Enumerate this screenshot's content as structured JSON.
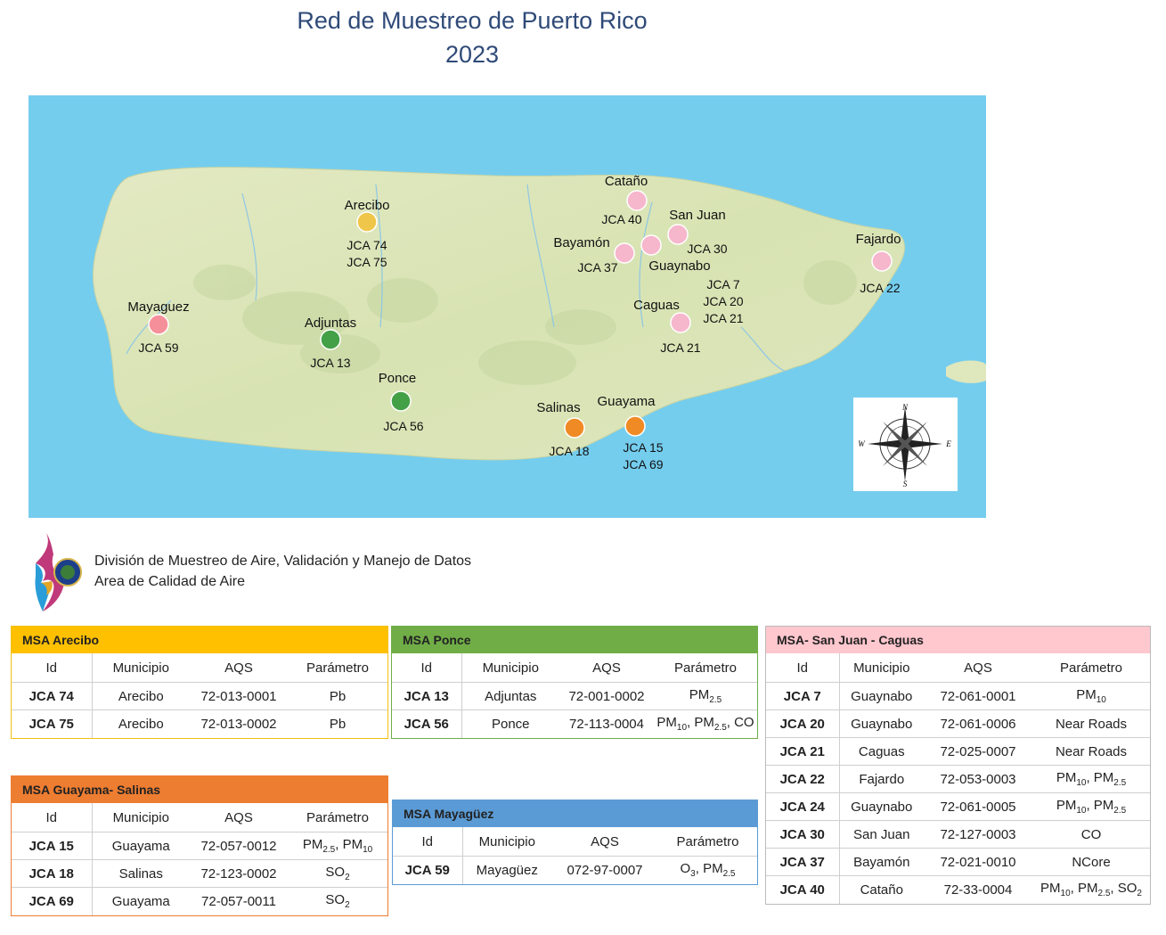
{
  "title": {
    "line1": "Red de Muestreo de Puerto Rico",
    "line2": "2023"
  },
  "map": {
    "sites": [
      {
        "name": "Arecibo",
        "ids": [
          "JCA 74",
          "JCA 75"
        ],
        "color": "#f0c64a"
      },
      {
        "name": "Mayaguez",
        "ids": [
          "JCA 59"
        ],
        "color": "#f5909a"
      },
      {
        "name": "Adjuntas",
        "ids": [
          "JCA 13"
        ],
        "color": "#43a047"
      },
      {
        "name": "Ponce",
        "ids": [
          "JCA 56"
        ],
        "color": "#43a047"
      },
      {
        "name": "Salinas",
        "ids": [
          "JCA 18"
        ],
        "color": "#f08a24"
      },
      {
        "name": "Guayama",
        "ids": [
          "JCA 15",
          "JCA 69"
        ],
        "color": "#f08a24"
      },
      {
        "name": "Cataño",
        "ids": [
          "JCA 40"
        ],
        "color": "#f6b6cc"
      },
      {
        "name": "San Juan",
        "ids": [
          "JCA 30"
        ],
        "color": "#f6b6cc"
      },
      {
        "name": "Bayamón",
        "ids": [
          "JCA 37"
        ],
        "color": "#f6b6cc"
      },
      {
        "name": "Guaynabo",
        "ids": [
          "JCA 7",
          "JCA 20",
          "JCA 21"
        ],
        "color": "#f6b6cc"
      },
      {
        "name": "Caguas",
        "ids": [
          "JCA 21"
        ],
        "color": "#f6b6cc"
      },
      {
        "name": "Fajardo",
        "ids": [
          "JCA 22"
        ],
        "color": "#f6b6cc"
      }
    ],
    "compass": {
      "n": "N",
      "s": "S",
      "e": "E",
      "w": "W"
    }
  },
  "org": {
    "line1": "División de Muestreo de Aire, Validación y Manejo de Datos",
    "line2": "Area de Calidad de Aire"
  },
  "columns": {
    "id": "Id",
    "municipio": "Municipio",
    "aqs": "AQS",
    "parametro": "Parámetro"
  },
  "tables": {
    "arecibo": {
      "title": "MSA Arecibo",
      "rows": [
        {
          "id": "JCA 74",
          "municipio": "Arecibo",
          "aqs": "72-013-0001",
          "parametro": "Pb"
        },
        {
          "id": "JCA 75",
          "municipio": "Arecibo",
          "aqs": "72-013-0002",
          "parametro": "Pb"
        }
      ]
    },
    "ponce": {
      "title": "MSA Ponce",
      "rows": [
        {
          "id": "JCA 13",
          "municipio": "Adjuntas",
          "aqs": "72-001-0002",
          "parametro": "PM2.5"
        },
        {
          "id": "JCA 56",
          "municipio": "Ponce",
          "aqs": "72-113-0004",
          "parametro": "PM10, PM2.5, CO"
        }
      ]
    },
    "sanjuan": {
      "title": "MSA- San Juan - Caguas",
      "rows": [
        {
          "id": "JCA 7",
          "municipio": "Guaynabo",
          "aqs": "72-061-0001",
          "parametro": "PM10"
        },
        {
          "id": "JCA 20",
          "municipio": "Guaynabo",
          "aqs": "72-061-0006",
          "parametro": "Near Roads"
        },
        {
          "id": "JCA 21",
          "municipio": "Caguas",
          "aqs": "72-025-0007",
          "parametro": "Near Roads"
        },
        {
          "id": "JCA 22",
          "municipio": "Fajardo",
          "aqs": "72-053-0003",
          "parametro": "PM10, PM2.5"
        },
        {
          "id": "JCA 24",
          "municipio": "Guaynabo",
          "aqs": "72-061-0005",
          "parametro": "PM10, PM2.5"
        },
        {
          "id": "JCA 30",
          "municipio": "San Juan",
          "aqs": "72-127-0003",
          "parametro": "CO"
        },
        {
          "id": "JCA 37",
          "municipio": "Bayamón",
          "aqs": "72-021-0010",
          "parametro": "NCore"
        },
        {
          "id": "JCA 40",
          "municipio": "Cataño",
          "aqs": "72-33-0004",
          "parametro": "PM10, PM2.5, SO2"
        }
      ]
    },
    "guayama": {
      "title": "MSA Guayama- Salinas",
      "rows": [
        {
          "id": "JCA 15",
          "municipio": "Guayama",
          "aqs": "72-057-0012",
          "parametro": "PM2.5, PM10"
        },
        {
          "id": "JCA 18",
          "municipio": "Salinas",
          "aqs": "72-123-0002",
          "parametro": "SO2"
        },
        {
          "id": "JCA 69",
          "municipio": "Guayama",
          "aqs": "72-057-0011",
          "parametro": "SO2"
        }
      ]
    },
    "mayaguez": {
      "title": "MSA Mayagüez",
      "rows": [
        {
          "id": "JCA 59",
          "municipio": "Mayagüez",
          "aqs": "072-97-0007",
          "parametro": "O3, PM2.5"
        }
      ]
    }
  }
}
